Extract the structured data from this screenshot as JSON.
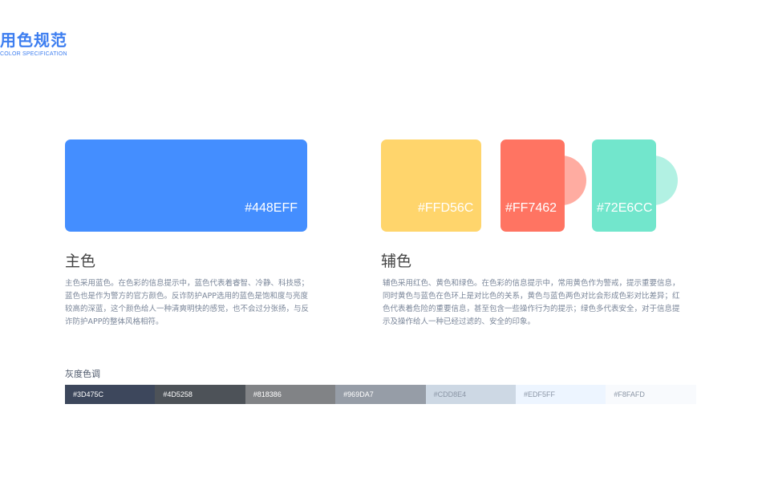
{
  "header": {
    "title": "用色规范",
    "subtitle": "COLOR SPECIFICATION",
    "accent": "#3D7EF0"
  },
  "primary": {
    "swatch": {
      "hex": "#448EFF",
      "color": "#448EFF"
    },
    "title": "主色",
    "description": "主色采用蓝色。在色彩的信息提示中，蓝色代表着睿智、冷静、科技感；蓝色也是作为警方的官方颜色。反诈防护APP选用的蓝色是饱和度与亮度较高的深蓝，这个颜色给人一种清爽明快的感觉，也不会过分张扬，与反诈防护APP的整体风格相符。"
  },
  "secondary": {
    "swatches": [
      {
        "hex": "#FFD56C",
        "color": "#FFD56C"
      },
      {
        "hex": "#FF7462",
        "color": "#FF7462"
      },
      {
        "hex": "#72E6CC",
        "color": "#72E6CC"
      }
    ],
    "title": "辅色",
    "description": "辅色采用红色、黄色和绿色。在色彩的信息提示中，常用黄色作为警戒，提示重要信息，同时黄色与蓝色在色环上是对比色的关系，黄色与蓝色两色对比会形成色彩对比差异；红色代表着危险的重要信息，甚至包含一些操作行为的提示；绿色多代表安全，对于信息提示及操作给人一种已经过滤的、安全的印象。"
  },
  "grays": {
    "title": "灰度色调",
    "swatches": [
      {
        "hex": "#3D475C",
        "color": "#3D475C",
        "text_color": "#FFFFFF"
      },
      {
        "hex": "#4D5258",
        "color": "#4D5258",
        "text_color": "#FFFFFF"
      },
      {
        "hex": "#818386",
        "color": "#818386",
        "text_color": "#FFFFFF"
      },
      {
        "hex": "#969DA7",
        "color": "#969DA7",
        "text_color": "#FFFFFF"
      },
      {
        "hex": "#CDD8E4",
        "color": "#CDD8E4",
        "text_color": "#8A95A5"
      },
      {
        "hex": "#EDF5FF",
        "color": "#EDF5FF",
        "text_color": "#8A95A5"
      },
      {
        "hex": "#F8FAFD",
        "color": "#F8FAFD",
        "text_color": "#8A95A5"
      }
    ]
  }
}
